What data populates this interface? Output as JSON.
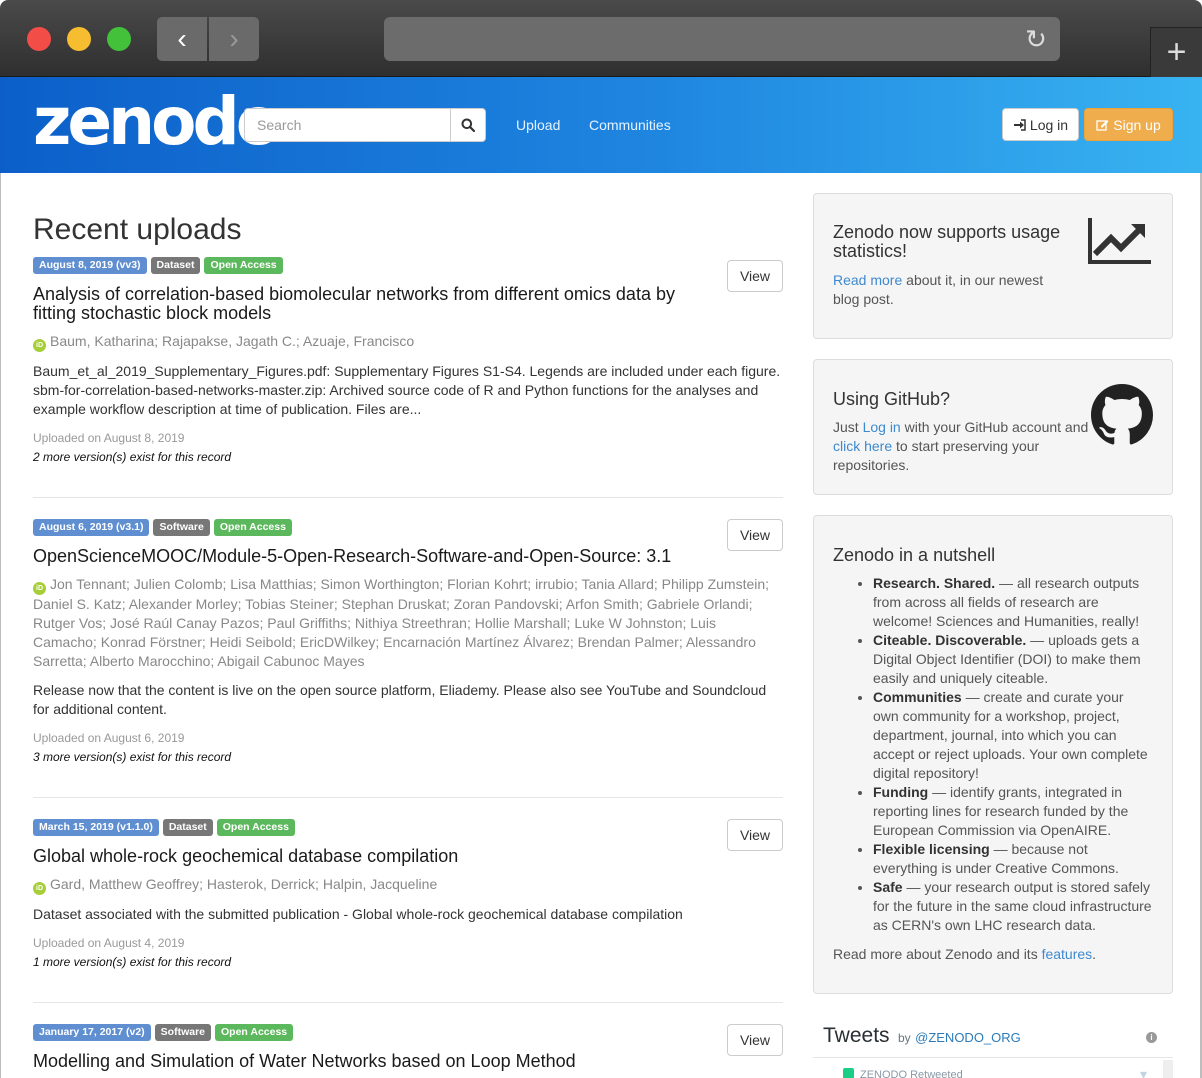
{
  "browser": {
    "back_glyph": "‹",
    "forward_glyph": "›",
    "reload_glyph": "↻",
    "new_tab_glyph": "+"
  },
  "header": {
    "logo": "zenodo",
    "search_placeholder": "Search",
    "links": {
      "upload": "Upload",
      "communities": "Communities"
    },
    "login": "Log in",
    "signup": "Sign up",
    "colors": {
      "gradient_start": "#0c5fc9",
      "gradient_end": "#38b3f1",
      "signup": "#f0ad4e"
    }
  },
  "main": {
    "title": "Recent uploads",
    "view_label": "View",
    "records": [
      {
        "date": "August 8, 2019 (vv3)",
        "type": "Dataset",
        "access": "Open Access",
        "title": "Analysis of correlation-based biomolecular networks from different omics data by fitting stochastic block models",
        "authors": "Baum, Katharina; Rajapakse, Jagath C.; Azuaje, Francisco",
        "description": "Baum_et_al_2019_Supplementary_Figures.pdf: Supplementary Figures S1-S4. Legends are included under each figure. sbm-for-correlation-based-networks-master.zip: Archived source code of R and Python functions for the analyses and example workflow description at time of publication. Files are...",
        "uploaded": "Uploaded on August 8, 2019",
        "versions": "2 more version(s) exist for this record"
      },
      {
        "date": "August 6, 2019 (v3.1)",
        "type": "Software",
        "access": "Open Access",
        "title": "OpenScienceMOOC/Module-5-Open-Research-Software-and-Open-Source: 3.1",
        "authors": "Jon Tennant; Julien Colomb; Lisa Matthias; Simon Worthington; Florian Kohrt; irrubio; Tania Allard; Philipp Zumstein; Daniel S. Katz; Alexander Morley; Tobias Steiner; Stephan Druskat; Zoran Pandovski; Arfon Smith; Gabriele Orlandi; Rutger Vos; José Raúl Canay Pazos; Paul Griffiths; Nithiya Streethran; Hollie Marshall; Luke W Johnston; Luis Camacho; Konrad Förstner; Heidi Seibold; EricDWilkey; Encarnación Martínez Álvarez; Brendan Palmer; Alessandro Sarretta; Alberto Marocchino; Abigail Cabunoc Mayes",
        "description": "Release now that the content is live on the open source platform, Eliademy. Please also see YouTube and Soundcloud for additional content.",
        "uploaded": "Uploaded on August 6, 2019",
        "versions": "3 more version(s) exist for this record"
      },
      {
        "date": "March 15, 2019 (v1.1.0)",
        "type": "Dataset",
        "access": "Open Access",
        "title": "Global whole-rock geochemical database compilation",
        "authors": "Gard, Matthew Geoffrey; Hasterok, Derrick; Halpin, Jacqueline",
        "description": "Dataset associated with the submitted publication - Global whole-rock geochemical database compilation",
        "uploaded": "Uploaded on August 4, 2019",
        "versions": "1 more version(s) exist for this record"
      },
      {
        "date": "January 17, 2017 (v2)",
        "type": "Software",
        "access": "Open Access",
        "title": "Modelling and Simulation of Water Networks based on Loop Method"
      }
    ]
  },
  "sidebar": {
    "stats": {
      "title": "Zenodo now supports usage statistics!",
      "link": "Read more",
      "text": " about it, in our newest blog post."
    },
    "github": {
      "title": "Using GitHub?",
      "t1": "Just ",
      "login": "Log in",
      "t2": " with your GitHub account and ",
      "click": "click here",
      "t3": " to start preserving your repositories."
    },
    "nutshell": {
      "title": "Zenodo in a nutshell",
      "items": [
        {
          "bold": "Research. Shared.",
          "text": " — all research outputs from across all fields of research are welcome! Sciences and Humanities, really!"
        },
        {
          "bold": "Citeable. Discoverable.",
          "text": " — uploads gets a Digital Object Identifier (DOI) to make them easily and uniquely citeable."
        },
        {
          "bold": "Communities",
          "text": " — create and curate your own community for a workshop, project, department, journal, into which you can accept or reject uploads. Your own complete digital repository!"
        },
        {
          "bold": "Funding",
          "text": " — identify grants, integrated in reporting lines for research funded by the European Commission via OpenAIRE."
        },
        {
          "bold": "Flexible licensing",
          "text": " — because not everything is under Creative Commons."
        },
        {
          "bold": "Safe",
          "text": " — your research output is stored safely for the future in the same cloud infrastructure as CERN's own LHC research data."
        }
      ],
      "more": "Read more about Zenodo and its ",
      "features": "features",
      "period": "."
    },
    "tweets": {
      "title": "Tweets",
      "by": "by",
      "handle": "@ZENODO_ORG",
      "info": "i",
      "first": "ZENODO Retweeted"
    }
  }
}
